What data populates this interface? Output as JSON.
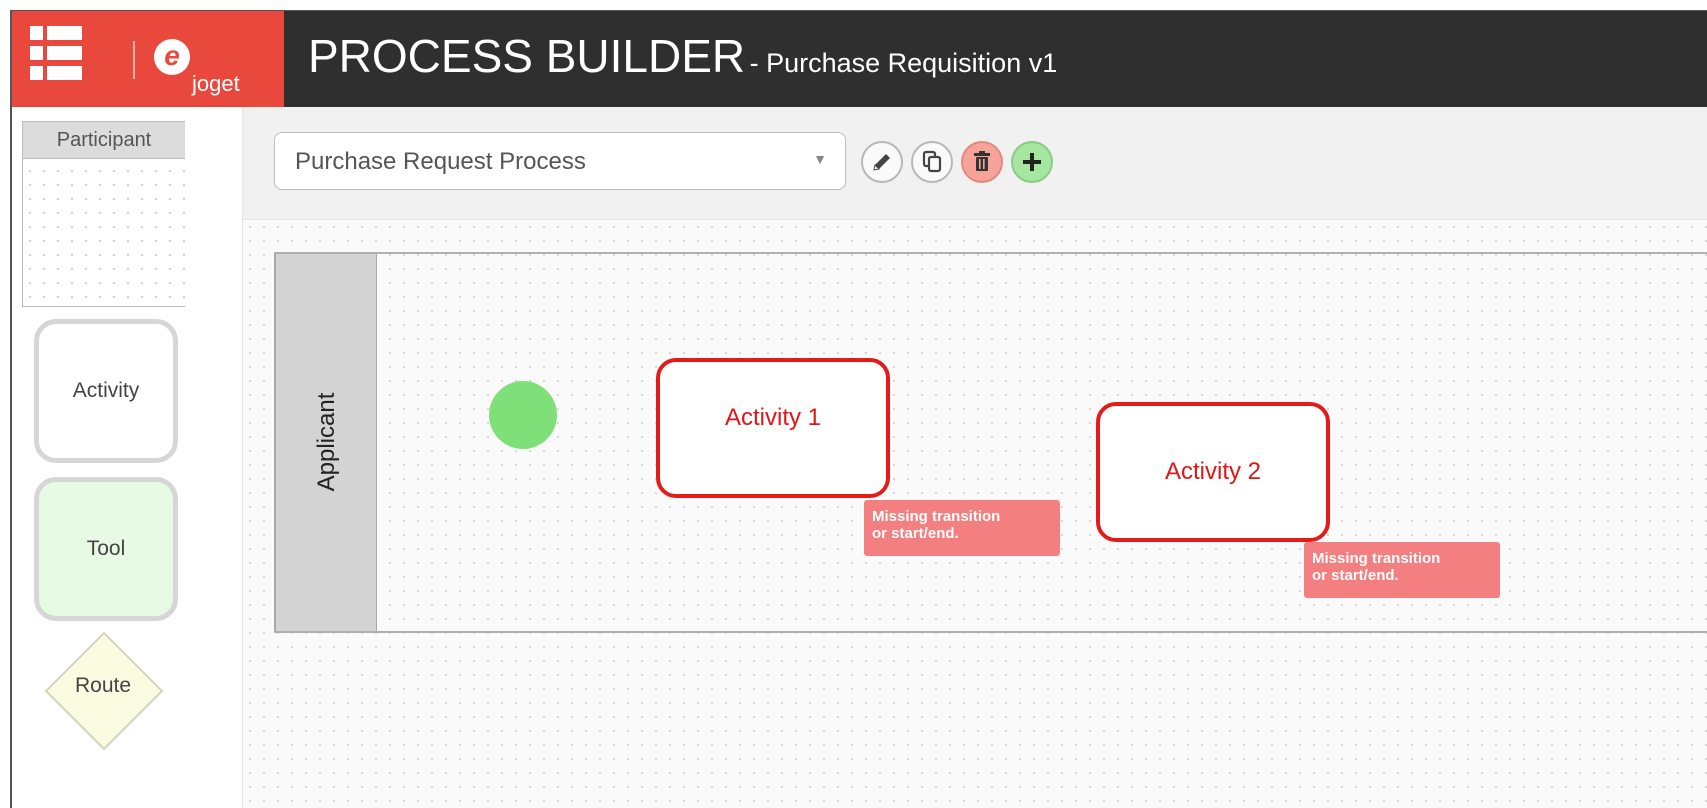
{
  "header": {
    "brand": "joget",
    "title": "PROCESS BUILDER",
    "subtitle": "- Purchase Requisition v1",
    "colors": {
      "brand_red": "#e9493c",
      "header_dark": "#2f2f2f"
    }
  },
  "palette": {
    "participant": "Participant",
    "activity": "Activity",
    "tool": "Tool",
    "route": "Route"
  },
  "toolbar": {
    "process_select": "Purchase Request Process",
    "icons": [
      "pencil-icon",
      "copy-icon",
      "trash-icon",
      "plus-icon"
    ]
  },
  "canvas": {
    "lane": "Applicant",
    "activities": [
      {
        "label": "Activity 1",
        "warning": {
          "line1": "Missing transition",
          "line2": "or start/end."
        }
      },
      {
        "label": "Activity 2",
        "warning": {
          "line1": "Missing transition",
          "line2": "or start/end."
        }
      }
    ],
    "colors": {
      "error_red": "#e31b1b",
      "warning_bg": "#f37f80",
      "start_green": "#7fe07a"
    }
  }
}
